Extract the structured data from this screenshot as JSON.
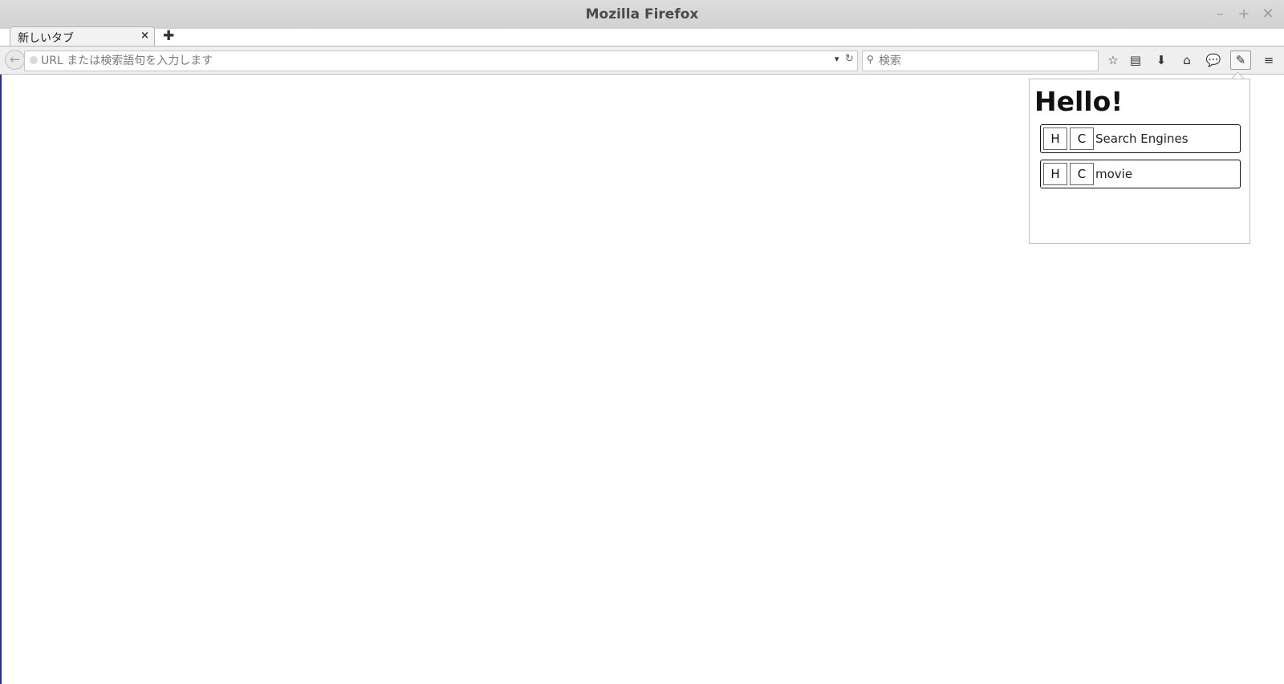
{
  "window": {
    "title": "Mozilla Firefox",
    "minimize": "–",
    "maximize": "+",
    "close": "✕"
  },
  "tabs": [
    {
      "label": "新しいタブ",
      "close": "×"
    }
  ],
  "new_tab": "✚",
  "navbar": {
    "back": "←",
    "url_placeholder": "URL または検索語句を入力します",
    "url_dropdown": "▾",
    "url_reload": "↻",
    "search_placeholder": "検索",
    "search_icon": "⚲",
    "buttons": {
      "bookmark": "☆",
      "library": "▤",
      "download": "⬇",
      "home": "⌂",
      "chat": "💬",
      "extension": "✎",
      "menu": "≡"
    }
  },
  "popup": {
    "title": "Hello!",
    "items": [
      {
        "h_label": "H",
        "c_label": "C",
        "label": "Search Engines"
      },
      {
        "h_label": "H",
        "c_label": "C",
        "label": "movie"
      }
    ]
  }
}
